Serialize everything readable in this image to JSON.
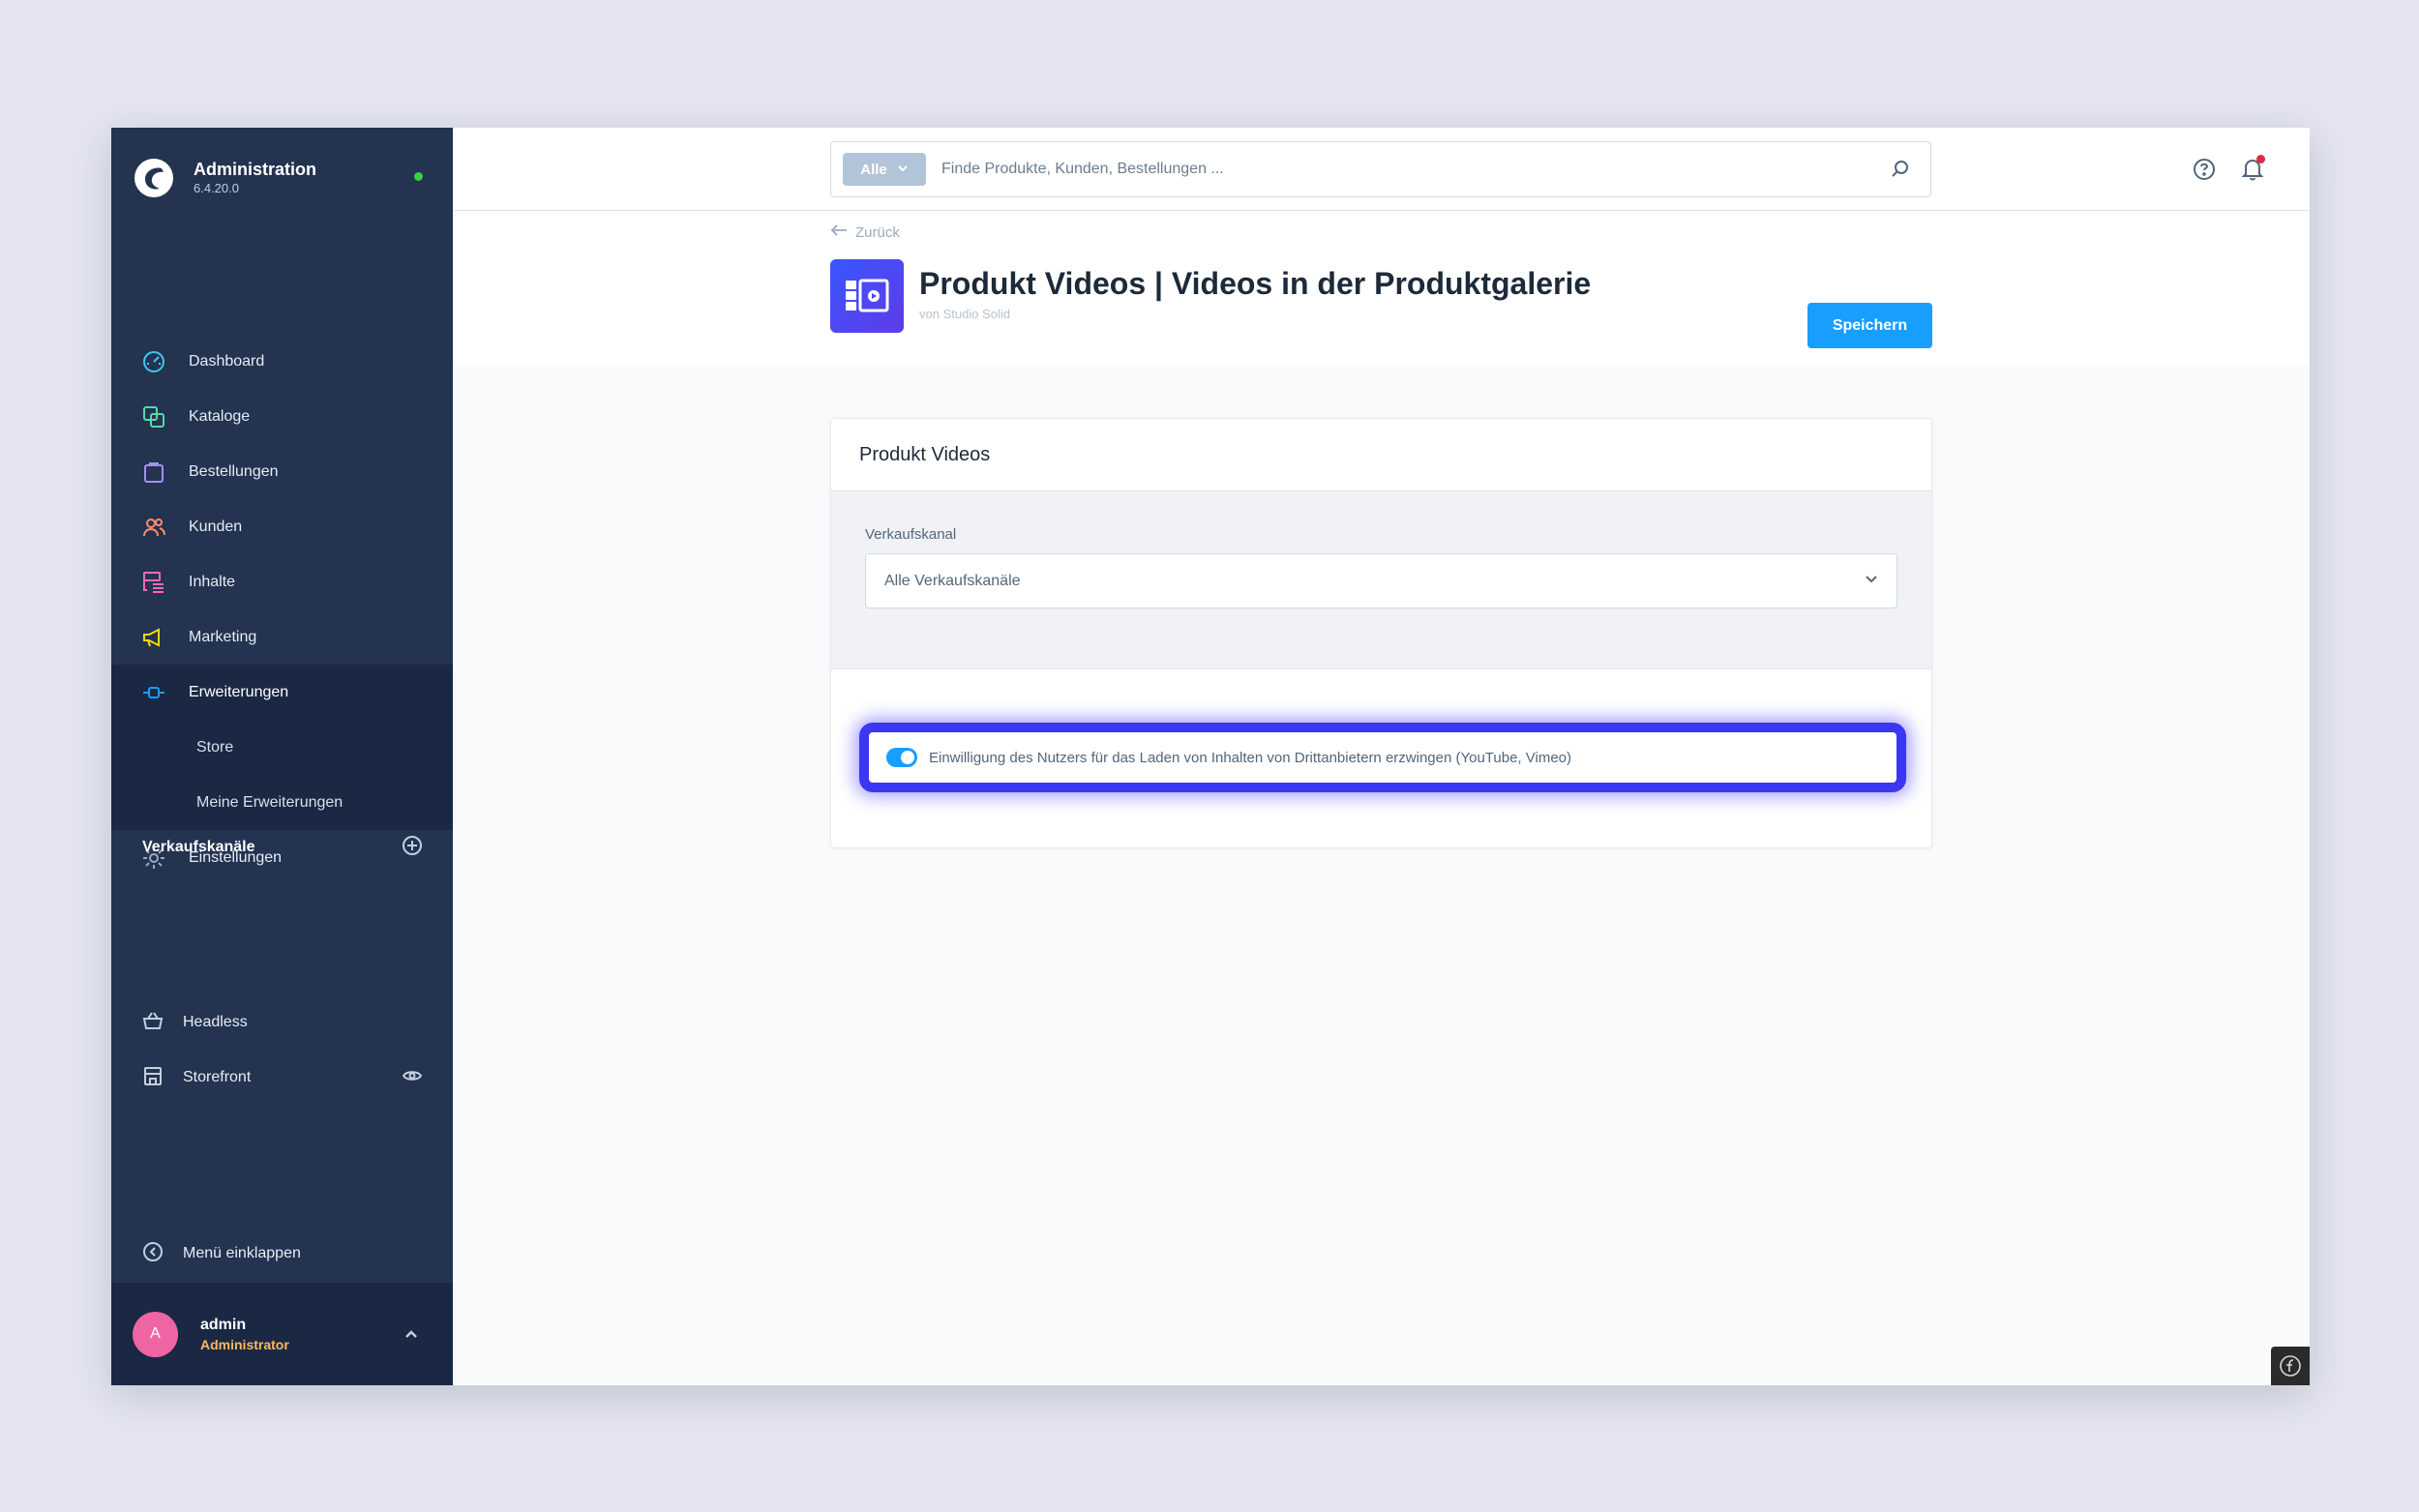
{
  "brand": {
    "title": "Administration",
    "version": "6.4.20.0"
  },
  "nav": {
    "dashboard": "Dashboard",
    "catalog": "Kataloge",
    "orders": "Bestellungen",
    "customers": "Kunden",
    "content": "Inhalte",
    "marketing": "Marketing",
    "extensions": "Erweiterungen",
    "store": "Store",
    "my_extensions": "Meine Erweiterungen",
    "settings": "Einstellungen"
  },
  "sales_channels": {
    "title": "Verkaufskanäle",
    "items": [
      "Headless",
      "Storefront"
    ]
  },
  "collapse_label": "Menü einklappen",
  "user": {
    "initial": "A",
    "name": "admin",
    "role": "Administrator"
  },
  "search": {
    "type": "Alle",
    "placeholder": "Finde Produkte, Kunden, Bestellungen ..."
  },
  "header": {
    "back": "Zurück",
    "title": "Produkt Videos | Videos in der Produktgalerie",
    "subtitle": "von Studio Solid",
    "save": "Speichern"
  },
  "card": {
    "title": "Produkt Videos",
    "field_label": "Verkaufskanal",
    "select_value": "Alle Verkaufskanäle",
    "toggle_label": "Einwilligung des Nutzers für das Laden von Inhalten von Drittanbietern erzwingen (YouTube, Vimeo)",
    "toggle_on": true
  },
  "colors": {
    "sidebar": "#233350",
    "accent": "#189eff",
    "highlight": "#3b36f2",
    "avatar": "#ef65a3",
    "role": "#ffb75d"
  }
}
